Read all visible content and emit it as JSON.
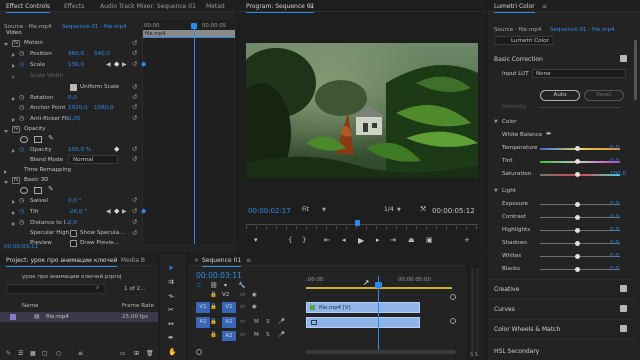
{
  "effect_controls": {
    "tabs": [
      "Effect Controls",
      "Effects",
      "Audio Track Mixer: Sequence 01",
      "Metad"
    ],
    "source_label": "Source · file.mp4",
    "sequence_label": "Sequence 01 · file.mp4",
    "timeline_time": "00:00",
    "timeline_time_right": "00:00:05",
    "clip_label": "file.mp4",
    "video_header": "Video",
    "motion": {
      "name": "Motion",
      "position_label": "Position",
      "position_x": "960,0",
      "position_y": "540,0",
      "scale_label": "Scale",
      "scale_value": "130,0",
      "scale_width_label": "Scale Width",
      "uniform_scale_label": "Uniform Scale",
      "rotation_label": "Rotation",
      "rotation_value": "0,0",
      "anchor_label": "Anchor Point",
      "anchor_x": "1920,0",
      "anchor_y": "1080,0",
      "antiflicker_label": "Anti-flicker Fil...",
      "antiflicker_value": "0,00"
    },
    "opacity": {
      "name": "Opacity",
      "opacity_label": "Opacity",
      "opacity_value": "100,0 %",
      "blend_label": "Blend Mode",
      "blend_value": "Normal"
    },
    "time_remapping": "Time Remapping",
    "basic3d": {
      "name": "Basic 3D",
      "swivel_label": "Swivel",
      "swivel_value": "0,0 °",
      "tilt_label": "Tilt",
      "tilt_value": "-26,0 °",
      "distance_label": "Distance to I...",
      "distance_value": "0,0",
      "specular_label": "Specular High...",
      "specular_check": "Show Specula...",
      "preview_label": "Preview",
      "preview_check": "Draw Previe..."
    },
    "bottom_time": "00:00:03:11"
  },
  "program": {
    "title": "Program: Sequence 01",
    "timecode": "00:00:02:17",
    "fit": "Fit",
    "resolution": "1/4",
    "duration": "00:00:05:12",
    "playhead_fraction": 0.48
  },
  "project": {
    "tabs": [
      "Project: урок про анимации ключей",
      "Media B"
    ],
    "file": "урок про анимации ключей.prproj",
    "count": "1 of 2...",
    "col_name": "Name",
    "col_fps": "Frame Rate",
    "item_name": "file.mp4",
    "item_fps": "25,00 fps"
  },
  "timeline": {
    "title": "Sequence 01",
    "timecode": "00:00:03:11",
    "ruler_start": ":00:00",
    "ruler_mid": "00:00:05:00",
    "tracks_video": [
      "V2",
      "V1"
    ],
    "tracks_audio": [
      "A1",
      "A2"
    ],
    "src_v": "V1",
    "src_a": "A1",
    "clip_video": "file.mp4 [V]",
    "clip_audio": ""
  },
  "lumetri": {
    "title": "Lumetri Color",
    "source_label": "Source · file.mp4",
    "sequence_label": "Sequence 01 · file.mp4",
    "effect_name": "Lumetri Color",
    "basic_correction": "Basic Correction",
    "input_lut_label": "Input LUT",
    "input_lut_value": "None",
    "intensity_label": "Intensity",
    "auto_label": "Auto",
    "reset_label": "Reset",
    "color_header": "Color",
    "white_balance": "White Balance",
    "temperature": "Temperature",
    "temperature_value": "0,0",
    "tint": "Tint",
    "tint_value": "0,0",
    "saturation": "Saturation",
    "saturation_value": "100,0",
    "light_header": "Light",
    "exposure": "Exposure",
    "exposure_value": "0,0",
    "contrast": "Contrast",
    "contrast_value": "0,0",
    "highlights": "Highlights",
    "highlights_value": "0,0",
    "shadows": "Shadows",
    "shadows_value": "0,0",
    "whites": "Whites",
    "whites_value": "0,0",
    "blacks": "Blacks",
    "blacks_value": "0,0",
    "sections": [
      "Creative",
      "Curves",
      "Color Wheels & Match",
      "HSL Secondary"
    ]
  },
  "colors": {
    "accent": "#2d8ceb",
    "clip_video": "#8fb4e8",
    "clip_audio": "#8fb4e8",
    "panel": "#232323"
  }
}
